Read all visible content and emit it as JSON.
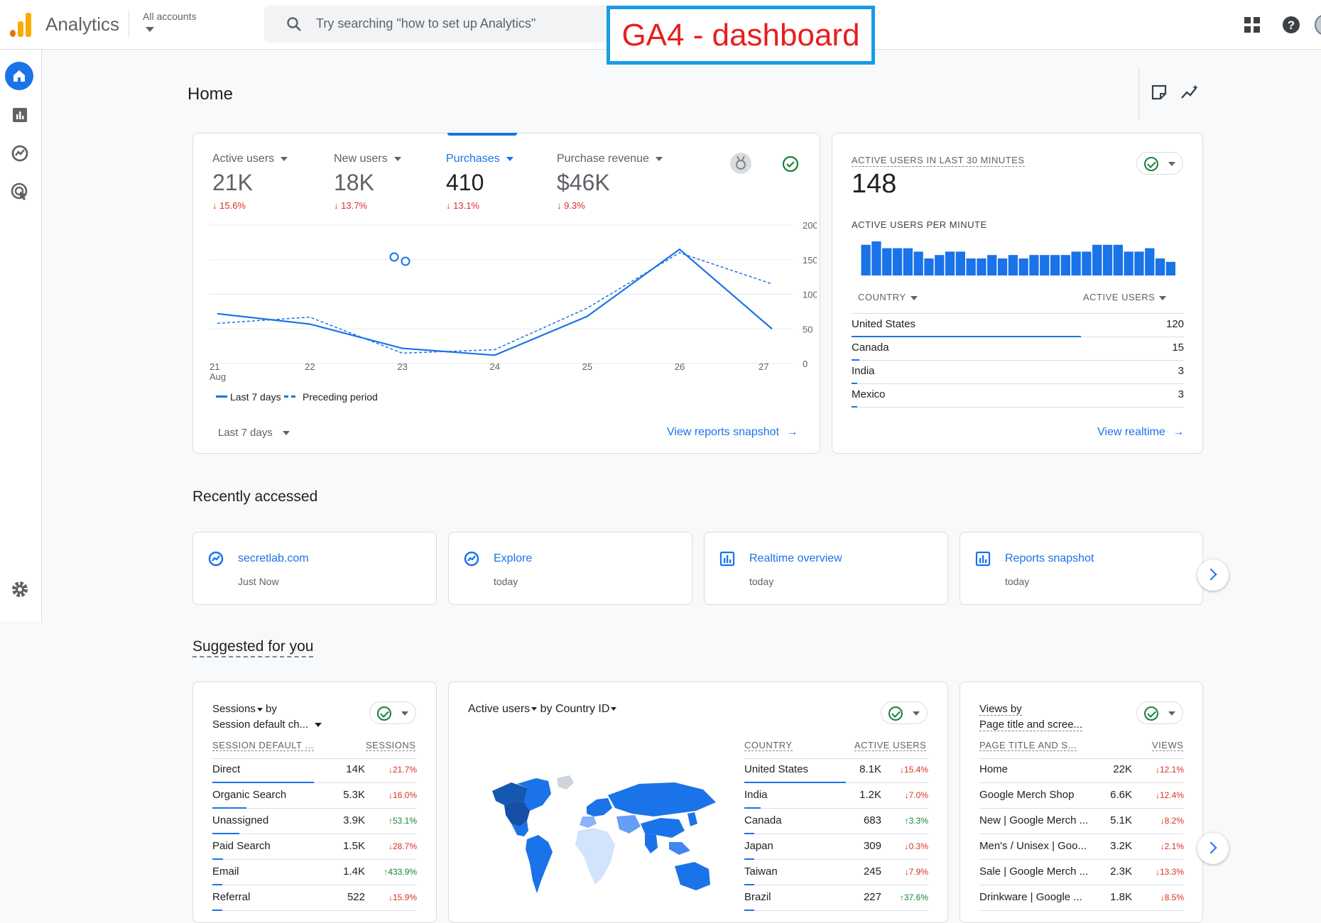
{
  "app": {
    "title": "Analytics",
    "accounts_label": "All accounts"
  },
  "search": {
    "placeholder": "Try searching \"how to set up Analytics\""
  },
  "annotation": "GA4 - dashboard",
  "page": {
    "title": "Home"
  },
  "colors": {
    "primary": "#1a73e8",
    "bar": "#1a73e8",
    "negative": "#d93025",
    "positive": "#188038",
    "annotation_border": "#1a9be8",
    "annotation_text": "#e81e1e"
  },
  "icons": [
    "search-icon",
    "apps-grid-icon",
    "help-icon",
    "home-icon",
    "reports-icon",
    "explore-icon",
    "advertising-icon",
    "settings-icon",
    "edit-note-icon",
    "insights-icon",
    "medal-icon",
    "check-icon",
    "arrow-right-icon",
    "chevron-right-icon"
  ],
  "overview": {
    "metrics": [
      {
        "label": "Active users",
        "value": "21K",
        "change": "15.6%"
      },
      {
        "label": "New users",
        "value": "18K",
        "change": "13.7%"
      },
      {
        "label": "Purchases",
        "value": "410",
        "change": "13.1%"
      },
      {
        "label": "Purchase revenue",
        "value": "$46K",
        "change": "9.3%"
      }
    ],
    "legend_current": "Last 7 days",
    "legend_previous": "Preceding period",
    "date_range": "Last 7 days",
    "link": "View reports snapshot"
  },
  "chart_data": {
    "type": "line",
    "x": [
      "21 Aug",
      "22",
      "23",
      "24",
      "25",
      "26",
      "27"
    ],
    "x_tick_day": [
      "21",
      "22",
      "23",
      "24",
      "25",
      "26",
      "27"
    ],
    "x_tick_month": "Aug",
    "y_ticks": [
      "0",
      "50",
      "100",
      "150",
      "200"
    ],
    "ylim": [
      0,
      200
    ],
    "series": [
      {
        "name": "Last 7 days",
        "values": [
          72,
          57,
          22,
          12,
          68,
          165,
          50
        ],
        "style": "solid"
      },
      {
        "name": "Preceding period",
        "values": [
          58,
          67,
          15,
          20,
          80,
          160,
          115
        ],
        "style": "dashed"
      }
    ]
  },
  "realtime": {
    "title": "ACTIVE USERS IN LAST 30 MINUTES",
    "value": "148",
    "per_minute_label": "ACTIVE USERS PER MINUTE",
    "per_minute_values": [
      9,
      10,
      8,
      8,
      8,
      7,
      5,
      6,
      7,
      7,
      5,
      5,
      6,
      5,
      6,
      5,
      6,
      6,
      6,
      6,
      7,
      7,
      9,
      9,
      9,
      7,
      7,
      8,
      5,
      4
    ],
    "col_country": "COUNTRY",
    "col_users": "ACTIVE USERS",
    "rows": [
      {
        "country": "United States",
        "users": "120",
        "share": 0.85
      },
      {
        "country": "Canada",
        "users": "15",
        "share": 0.03
      },
      {
        "country": "India",
        "users": "3",
        "share": 0.02
      },
      {
        "country": "Mexico",
        "users": "3",
        "share": 0.02
      }
    ],
    "link": "View realtime"
  },
  "recent": {
    "title": "Recently accessed",
    "items": [
      {
        "title": "secretlab.com",
        "sub": "Just Now"
      },
      {
        "title": "Explore",
        "sub": "today"
      },
      {
        "title": "Realtime overview",
        "sub": "today"
      },
      {
        "title": "Reports snapshot",
        "sub": "today"
      }
    ]
  },
  "suggested": {
    "title": "Suggested for you",
    "sessions": {
      "title_metric": "Sessions",
      "title_by": "by",
      "title_dim": "Session default ch...",
      "col_dim": "SESSION DEFAULT ...",
      "col_metric": "SESSIONS",
      "rows": [
        {
          "label": "Direct",
          "value": "14K",
          "change": "21.7%",
          "dir": "down",
          "share": 0.75
        },
        {
          "label": "Organic Search",
          "value": "5.3K",
          "change": "16.0%",
          "dir": "down",
          "share": 0.25
        },
        {
          "label": "Unassigned",
          "value": "3.9K",
          "change": "53.1%",
          "dir": "up",
          "share": 0.2
        },
        {
          "label": "Paid Search",
          "value": "1.5K",
          "change": "28.7%",
          "dir": "down",
          "share": 0.08
        },
        {
          "label": "Email",
          "value": "1.4K",
          "change": "433.9%",
          "dir": "up",
          "share": 0.07
        },
        {
          "label": "Referral",
          "value": "522",
          "change": "15.9%",
          "dir": "down",
          "share": 0.03
        }
      ]
    },
    "country": {
      "title_metric": "Active users",
      "title_by": "by Country ID",
      "col_dim": "COUNTRY",
      "col_metric": "ACTIVE USERS",
      "rows": [
        {
          "label": "United States",
          "value": "8.1K",
          "change": "15.4%",
          "dir": "down",
          "share": 0.75
        },
        {
          "label": "India",
          "value": "1.2K",
          "change": "7.0%",
          "dir": "down",
          "share": 0.12
        },
        {
          "label": "Canada",
          "value": "683",
          "change": "3.3%",
          "dir": "up",
          "share": 0.07
        },
        {
          "label": "Japan",
          "value": "309",
          "change": "0.3%",
          "dir": "down",
          "share": 0.03
        },
        {
          "label": "Taiwan",
          "value": "245",
          "change": "7.9%",
          "dir": "down",
          "share": 0.03
        },
        {
          "label": "Brazil",
          "value": "227",
          "change": "37.6%",
          "dir": "up",
          "share": 0.02
        }
      ]
    },
    "views": {
      "title_metric": "Views by",
      "title_dim": "Page title and scree...",
      "col_dim": "PAGE TITLE AND S...",
      "col_metric": "VIEWS",
      "rows": [
        {
          "label": "Home",
          "value": "22K",
          "change": "12.1%",
          "dir": "down"
        },
        {
          "label": "Google Merch Shop",
          "value": "6.6K",
          "change": "12.4%",
          "dir": "down"
        },
        {
          "label": "New | Google Merch ...",
          "value": "5.1K",
          "change": "8.2%",
          "dir": "down"
        },
        {
          "label": "Men's / Unisex | Goo...",
          "value": "3.2K",
          "change": "2.1%",
          "dir": "down"
        },
        {
          "label": "Sale | Google Merch ...",
          "value": "2.3K",
          "change": "13.3%",
          "dir": "down"
        },
        {
          "label": "Drinkware | Google ...",
          "value": "1.8K",
          "change": "8.5%",
          "dir": "down"
        }
      ]
    }
  }
}
